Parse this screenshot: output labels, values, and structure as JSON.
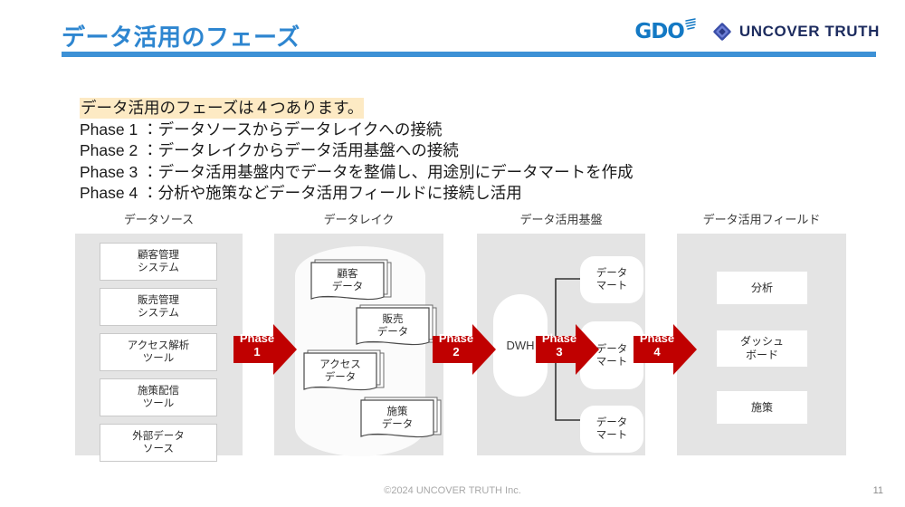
{
  "header": {
    "title": "データ活用のフェーズ",
    "rule_color": "#3d91d6",
    "title_color": "#2e86d0",
    "logos": {
      "gdo_text": "GDO",
      "uncover_truth_text": "UNCOVER TRUTH"
    }
  },
  "lead": {
    "line1": "データ活用のフェーズは４つあります。",
    "line2": "Phase 1 ：データソースからデータレイクへの接続",
    "line3": "Phase 2 ：データレイクからデータ活用基盤への接続",
    "line4": "Phase 3 ：データ活用基盤内でデータを整備し、用途別にデータマートを作成",
    "line5": "Phase 4 ：分析や施策などデータ活用フィールドに接続し活用",
    "highlight_color": "#fdeac4"
  },
  "diagram": {
    "accent_color": "#c00000",
    "panel_color": "#e4e4e4",
    "columns": [
      {
        "header": "データソース"
      },
      {
        "header": "データレイク"
      },
      {
        "header": "データ活用基盤"
      },
      {
        "header": "データ活用フィールド"
      }
    ],
    "sources": [
      {
        "line1": "顧客管理",
        "line2": "システム"
      },
      {
        "line1": "販売管理",
        "line2": "システム"
      },
      {
        "line1": "アクセス解析",
        "line2": "ツール"
      },
      {
        "line1": "施策配信",
        "line2": "ツール"
      },
      {
        "line1": "外部データ",
        "line2": "ソース"
      }
    ],
    "lake_cards": [
      {
        "line1": "顧客",
        "line2": "データ"
      },
      {
        "line1": "販売",
        "line2": "データ"
      },
      {
        "line1": "アクセス",
        "line2": "データ"
      },
      {
        "line1": "施策",
        "line2": "データ"
      }
    ],
    "dwh": {
      "label": "DWH"
    },
    "marts": [
      {
        "line1": "データ",
        "line2": "マート"
      },
      {
        "line1": "データ",
        "line2": "マート"
      },
      {
        "line1": "データ",
        "line2": "マート"
      }
    ],
    "fields": [
      {
        "line1": "分析",
        "line2": ""
      },
      {
        "line1": "ダッシュ",
        "line2": "ボード"
      },
      {
        "line1": "施策",
        "line2": ""
      }
    ],
    "phases": [
      {
        "label": "Phase",
        "number": "1"
      },
      {
        "label": "Phase",
        "number": "2"
      },
      {
        "label": "Phase",
        "number": "3"
      },
      {
        "label": "Phase",
        "number": "4"
      }
    ]
  },
  "footer": {
    "copyright": "©2024 UNCOVER TRUTH Inc.",
    "page_number": "11"
  }
}
